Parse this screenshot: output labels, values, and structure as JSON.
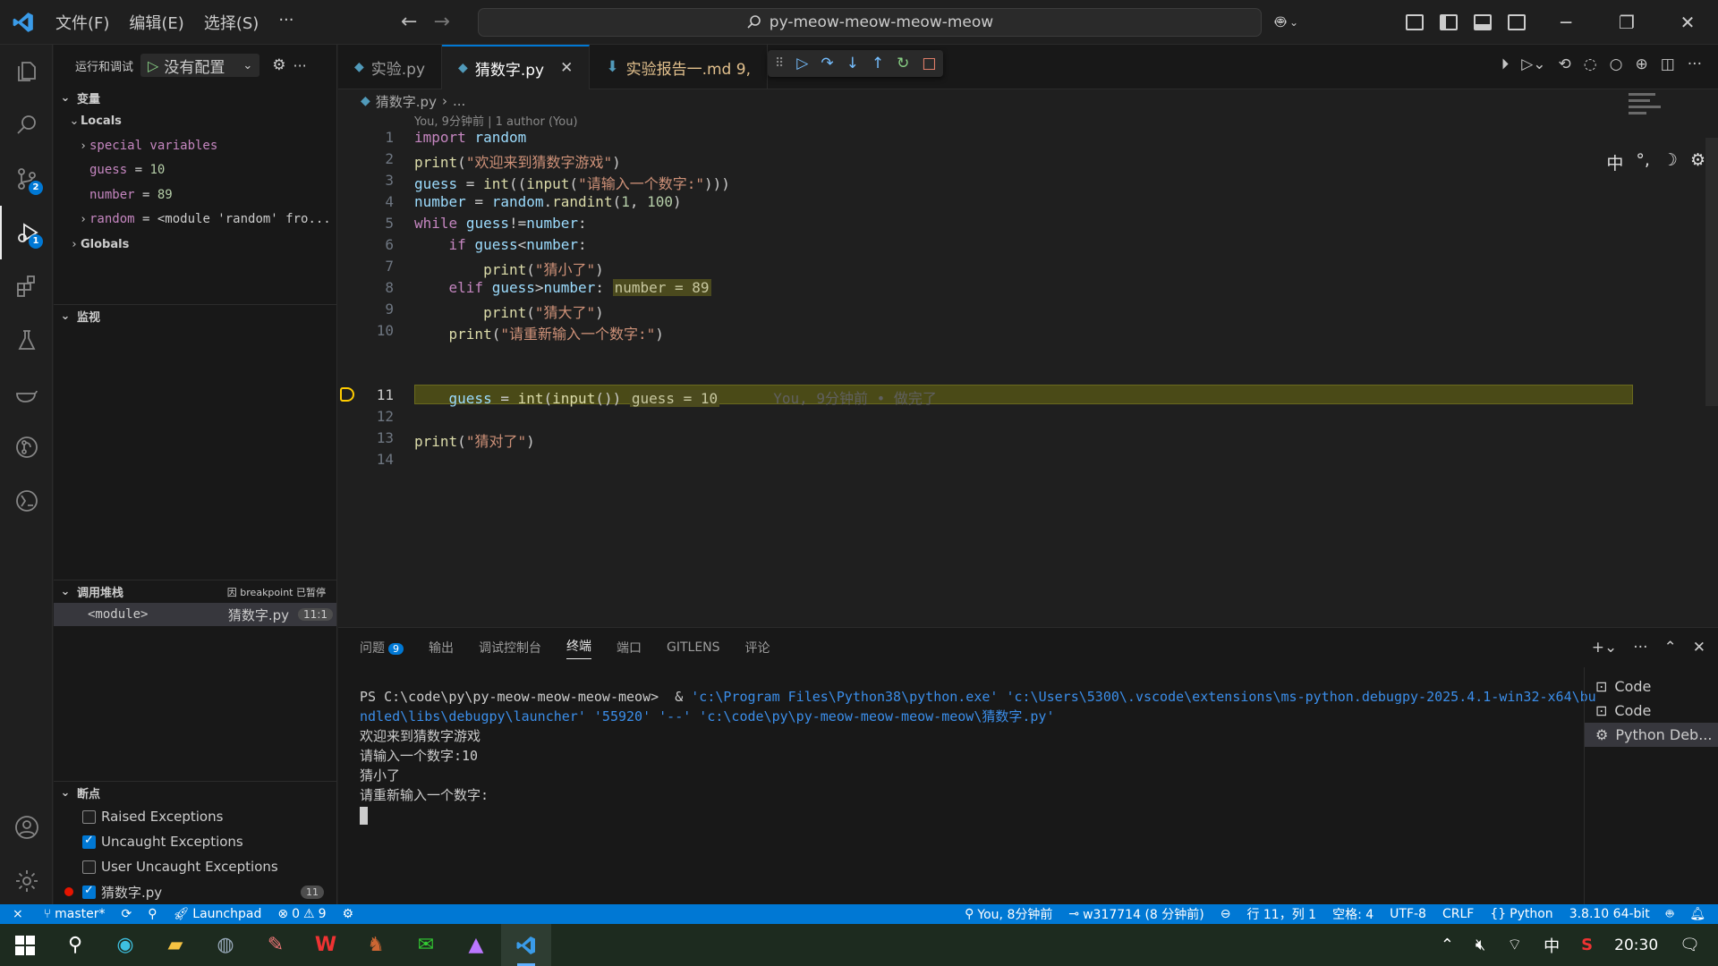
{
  "titlebar": {
    "menus": [
      "文件(F)",
      "编辑(E)",
      "选择(S)",
      "···"
    ],
    "search_text": "py-meow-meow-meow-meow"
  },
  "activity": {
    "scm_badge": "2",
    "debug_badge": "1"
  },
  "sidebar": {
    "run_label": "运行和调试",
    "config_label": "没有配置",
    "variables_title": "变量",
    "locals_title": "Locals",
    "locals": [
      {
        "name": "special variables",
        "value": ""
      },
      {
        "name": "guess",
        "value": "10"
      },
      {
        "name": "number",
        "value": "89"
      },
      {
        "name": "random",
        "value": "<module 'random' fro..."
      }
    ],
    "globals_title": "Globals",
    "watch_title": "监视",
    "callstack_title": "调用堆栈",
    "callstack_status": "因 breakpoint 已暂停",
    "callstack_frame": "<module>",
    "callstack_file": "猜数字.py",
    "callstack_pos": "11:1",
    "breakpoints_title": "断点",
    "breakpoints": [
      {
        "label": "Raised Exceptions",
        "checked": false
      },
      {
        "label": "Uncaught Exceptions",
        "checked": true
      },
      {
        "label": "User Uncaught Exceptions",
        "checked": false
      }
    ],
    "bp_file": "猜数字.py",
    "bp_line": "11"
  },
  "editor": {
    "tabs": [
      {
        "label": "实验.py"
      },
      {
        "label": "猜数字.py"
      },
      {
        "label": "实验报告一.md 9,"
      }
    ],
    "breadcrumb_file": "猜数字.py",
    "breadcrumb_rest": "...",
    "blame_header": "You, 9分钟前 | 1 author (You)",
    "line_numbers": [
      "1",
      "2",
      "3",
      "4",
      "5",
      "6",
      "7",
      "8",
      "9",
      "10",
      "11",
      "12",
      "13",
      "14"
    ],
    "inline_value_8": "number = 89",
    "inline_value_11": "guess = 10",
    "ghost_blame": "You, 9分钟前 • 做完了",
    "ime_toolbar": "中"
  },
  "panel": {
    "tabs": [
      "问题",
      "输出",
      "调试控制台",
      "终端",
      "端口",
      "GITLENS",
      "评论"
    ],
    "problems_count": "9",
    "terminal": {
      "prompt": "PS C:\\code\\py\\py-meow-meow-meow-meow> ",
      "amp": " & ",
      "command": "'c:\\Program Files\\Python38\\python.exe' 'c:\\Users\\5300\\.vscode\\extensions\\ms-python.debugpy-2025.4.1-win32-x64\\bundled\\libs\\debugpy\\launcher' '55920' '--' 'c:\\code\\py\\py-meow-meow-meow-meow\\猜数字.py'",
      "out1": "欢迎来到猜数字游戏",
      "out2": "请输入一个数字:10",
      "out3": "猜小了",
      "out4": "请重新输入一个数字:"
    },
    "terminal_list": [
      "Code",
      "Code",
      "Python Deb..."
    ]
  },
  "statusbar": {
    "branch": "master*",
    "launchpad": "Launchpad",
    "errors": "0",
    "warnings": "9",
    "blame": "You, 8分钟前",
    "commit": "w317714 (8 分钟前)",
    "position": "行 11，列 1",
    "spaces": "空格: 4",
    "encoding": "UTF-8",
    "eol": "CRLF",
    "language": "Python",
    "interpreter": "3.8.10 64-bit"
  },
  "taskbar": {
    "time": "20:30",
    "ime": "中"
  }
}
